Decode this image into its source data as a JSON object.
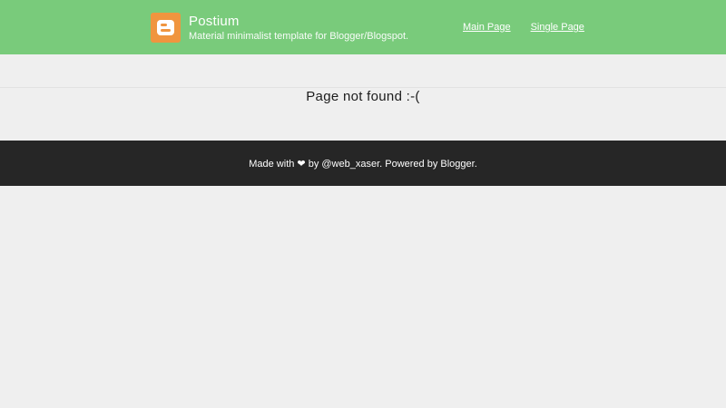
{
  "header": {
    "site_title": "Postium",
    "site_description": "Material minimalist template for Blogger/Blogspot.",
    "logo_icon": "blogger-icon",
    "nav": [
      {
        "label": "Main Page"
      },
      {
        "label": "Single Page"
      }
    ],
    "background_color": "#79cb7b",
    "logo_color": "#f0953f"
  },
  "main": {
    "message": "Page not found :-("
  },
  "footer": {
    "text": "Made with ❤ by @web_xaser. Powered by Blogger.",
    "background_color": "#262626"
  }
}
